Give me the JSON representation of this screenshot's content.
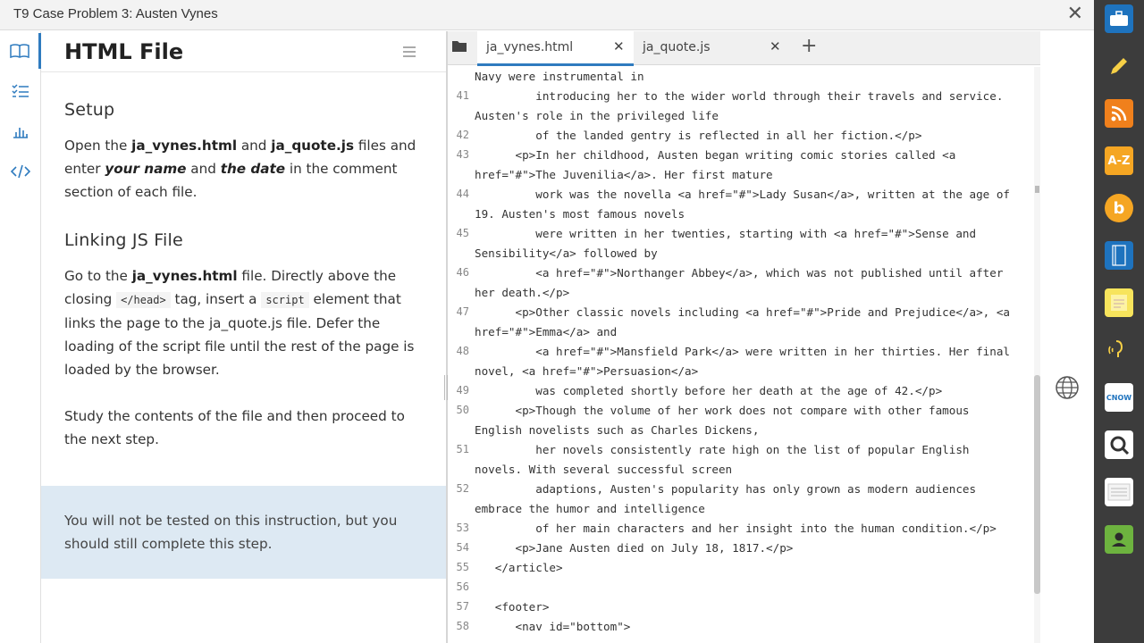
{
  "window": {
    "title": "T9 Case Problem 3: Austen Vynes",
    "close_symbol": "✕"
  },
  "instructions": {
    "heading": "HTML File",
    "sections": [
      {
        "title": "Setup"
      },
      {
        "title": "Linking JS File"
      }
    ],
    "setup_p": {
      "a": "Open the ",
      "b": "ja_vynes.html",
      "c": " and ",
      "d": "ja_quote.js",
      "e": " files and enter ",
      "f": "your name",
      "g": " and ",
      "h": "the date",
      "i": " in the comment section of each file."
    },
    "link_p": {
      "a": "Go to the ",
      "b": "ja_vynes.html",
      "c": " file. Directly above the closing ",
      "code1": "</head>",
      "d": " tag, insert a ",
      "code2": "script",
      "e": " element that links the page to the ja_quote.js file. Defer the loading of the script file until the rest of the page is loaded by the browser."
    },
    "study_p": "Study the contents of the file and then proceed to the next step.",
    "note": "You will not be tested on this instruction, but you should still complete this step."
  },
  "editor": {
    "tabs": [
      {
        "label": "ja_vynes.html",
        "active": true
      },
      {
        "label": "ja_quote.js",
        "active": false
      }
    ],
    "add_symbol": "+",
    "lines": [
      {
        "num": "",
        "text": "Navy were instrumental in"
      },
      {
        "num": "41",
        "text": "         introducing her to the wider world through their travels and service."
      },
      {
        "num": "",
        "text": "Austen's role in the privileged life"
      },
      {
        "num": "42",
        "text": "         of the landed gentry is reflected in all her fiction.</p>"
      },
      {
        "num": "43",
        "text": "      <p>In her childhood, Austen began writing comic stories called <a"
      },
      {
        "num": "",
        "text": "href=\"#\">The Juvenilia</a>. Her first mature"
      },
      {
        "num": "44",
        "text": "         work was the novella <a href=\"#\">Lady Susan</a>, written at the age of"
      },
      {
        "num": "",
        "text": "19. Austen's most famous novels"
      },
      {
        "num": "45",
        "text": "         were written in her twenties, starting with <a href=\"#\">Sense and"
      },
      {
        "num": "",
        "text": "Sensibility</a> followed by"
      },
      {
        "num": "46",
        "text": "         <a href=\"#\">Northanger Abbey</a>, which was not published until after"
      },
      {
        "num": "",
        "text": "her death.</p>"
      },
      {
        "num": "47",
        "text": "      <p>Other classic novels including <a href=\"#\">Pride and Prejudice</a>, <a"
      },
      {
        "num": "",
        "text": "href=\"#\">Emma</a> and"
      },
      {
        "num": "48",
        "text": "         <a href=\"#\">Mansfield Park</a> were written in her thirties. Her final"
      },
      {
        "num": "",
        "text": "novel, <a href=\"#\">Persuasion</a>"
      },
      {
        "num": "49",
        "text": "         was completed shortly before her death at the age of 42.</p>"
      },
      {
        "num": "50",
        "text": "      <p>Though the volume of her work does not compare with other famous"
      },
      {
        "num": "",
        "text": "English novelists such as Charles Dickens,"
      },
      {
        "num": "51",
        "text": "         her novels consistently rate high on the list of popular English"
      },
      {
        "num": "",
        "text": "novels. With several successful screen"
      },
      {
        "num": "52",
        "text": "         adaptions, Austen's popularity has only grown as modern audiences"
      },
      {
        "num": "",
        "text": "embrace the humor and intelligence"
      },
      {
        "num": "53",
        "text": "         of her main characters and her insight into the human condition.</p>"
      },
      {
        "num": "54",
        "text": "      <p>Jane Austen died on July 18, 1817.</p>"
      },
      {
        "num": "55",
        "text": "   </article>"
      },
      {
        "num": "56",
        "text": ""
      },
      {
        "num": "57",
        "text": "   <footer>"
      },
      {
        "num": "58",
        "text": "      <nav id=\"bottom\">"
      }
    ]
  },
  "dock": {
    "items": [
      {
        "name": "briefcase-icon",
        "glyph": "",
        "color": "#1e73be"
      },
      {
        "name": "pen-icon",
        "glyph": "",
        "color": "#3c3c3c"
      },
      {
        "name": "rss-icon",
        "glyph": "",
        "color": "#f0801c"
      },
      {
        "name": "az-dictionary-icon",
        "glyph": "A-Z",
        "color": "#f5a623"
      },
      {
        "name": "bing-icon",
        "glyph": "b",
        "color": "#f5a623"
      },
      {
        "name": "book-icon",
        "glyph": "",
        "color": "#1e73be"
      },
      {
        "name": "notepad-icon",
        "glyph": "",
        "color": "#f7e45c"
      },
      {
        "name": "text-to-speech-icon",
        "glyph": "",
        "color": "#3c3c3c"
      },
      {
        "name": "cnow-icon",
        "glyph": "CNOW",
        "color": "#ffffff"
      },
      {
        "name": "search-app-icon",
        "glyph": "",
        "color": "#ffffff"
      },
      {
        "name": "notes-stack-icon",
        "glyph": "",
        "color": "#ffffff"
      },
      {
        "name": "profile-icon",
        "glyph": "",
        "color": "#6db33f"
      }
    ]
  }
}
